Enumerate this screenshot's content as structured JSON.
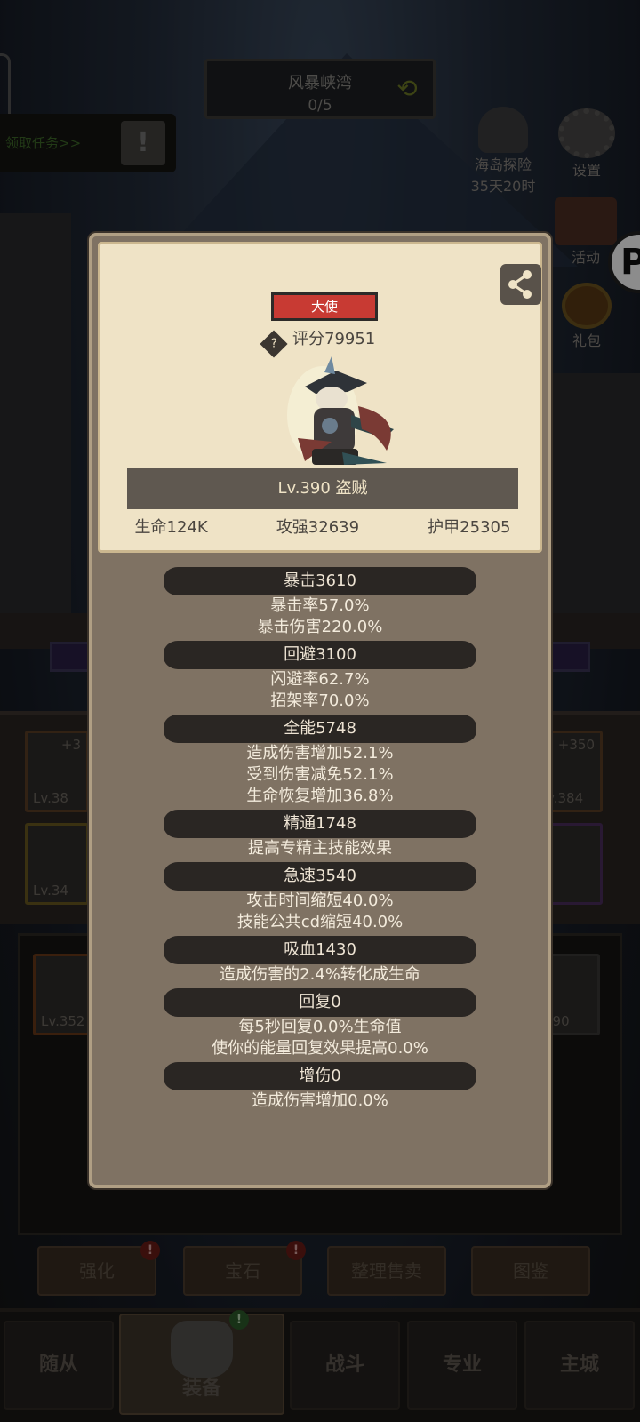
{
  "location": {
    "name": "风暴峡湾",
    "progress": "0/5"
  },
  "quest": {
    "label": "领取任务>>"
  },
  "side_buttons": {
    "explore": {
      "label": "海岛探险",
      "timer": "35天20时"
    },
    "settings": {
      "label": "设置"
    },
    "activity": {
      "label": "活动"
    },
    "gift": {
      "label": "礼包"
    }
  },
  "popup": {
    "title_tag": "大使",
    "score_label": "评分79951",
    "name_level": "Lv.390 盗贼",
    "main_stats": [
      "生命124K",
      "攻强32639",
      "护甲25305"
    ],
    "sections": [
      {
        "header": "暴击3610",
        "lines": [
          "暴击率57.0%",
          "暴击伤害220.0%"
        ]
      },
      {
        "header": "回避3100",
        "lines": [
          "闪避率62.7%",
          "招架率70.0%"
        ]
      },
      {
        "header": "全能5748",
        "lines": [
          "造成伤害增加52.1%",
          "受到伤害减免52.1%",
          "生命恢复增加36.8%"
        ]
      },
      {
        "header": "精通1748",
        "lines": [
          "提高专精主技能效果"
        ]
      },
      {
        "header": "急速3540",
        "lines": [
          "攻击时间缩短40.0%",
          "技能公共cd缩短40.0%"
        ]
      },
      {
        "header": "吸血1430",
        "lines": [
          "造成伤害的2.4%转化成生命"
        ]
      },
      {
        "header": "回复0",
        "lines": [
          "每5秒回复0.0%生命值",
          "使你的能量回复效果提高0.0%"
        ]
      },
      {
        "header": "增伤0",
        "lines": [
          "造成伤害增加0.0%"
        ]
      }
    ]
  },
  "equipment_slots": [
    {
      "plus": "+3",
      "level": "Lv.38"
    },
    {
      "plus": "+350",
      "level": "v.384"
    },
    {
      "plus": "",
      "level": "Lv.34"
    },
    {
      "plus": "",
      "level": "Lv.352"
    },
    {
      "plus": "",
      "level": "390"
    }
  ],
  "action_buttons": [
    "强化",
    "宝石",
    "整理售卖",
    "图鉴"
  ],
  "nav": [
    "随从",
    "装备",
    "战斗",
    "专业",
    "主城"
  ],
  "badges": {
    "alert": "!"
  },
  "avatar_letter": "P",
  "colors": {
    "accent_red": "#c83a33",
    "panel": "#7f7263",
    "card": "#efe3c6"
  }
}
